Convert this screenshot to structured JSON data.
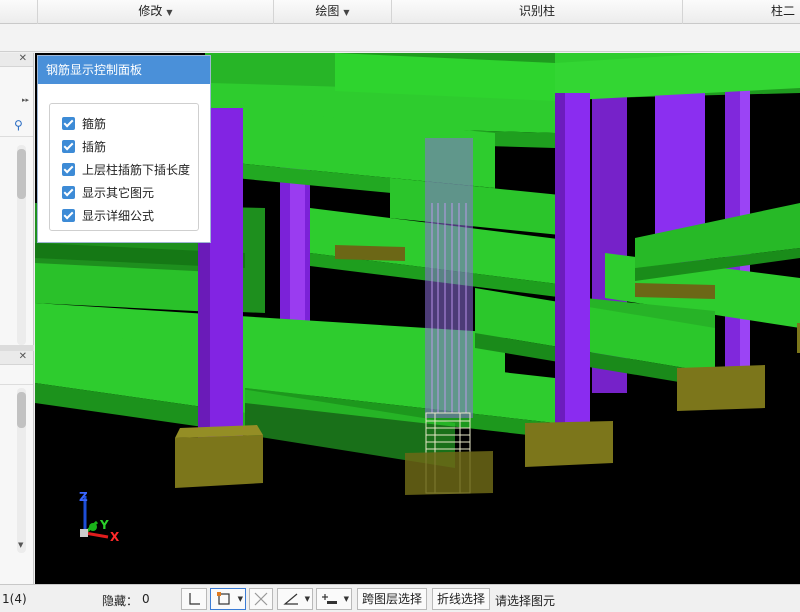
{
  "ribbon": {
    "sections": [
      {
        "label": "修改",
        "has_dropdown": true
      },
      {
        "label": "绘图",
        "has_dropdown": true
      },
      {
        "label": "识别柱",
        "has_dropdown": false
      },
      {
        "label": "柱二次",
        "has_dropdown": false
      }
    ]
  },
  "rebar_panel": {
    "title": "钢筋显示控制面板",
    "options": [
      {
        "label": "箍筋",
        "checked": true
      },
      {
        "label": "插筋",
        "checked": true
      },
      {
        "label": "上层柱插筋下插长度",
        "checked": true
      },
      {
        "label": "显示其它图元",
        "checked": true
      },
      {
        "label": "显示详细公式",
        "checked": true
      }
    ]
  },
  "axes": {
    "z": "Z",
    "y": "Y",
    "x": "X"
  },
  "statusbar": {
    "count": "1(4)",
    "hidden_label": "隐藏：",
    "hidden_value": "0",
    "cross_layer_select": "跨图层选择",
    "polyline_select": "折线选择",
    "prompt": "请选择图元"
  },
  "colors": {
    "beam": "#2ecc2e",
    "column": "#8a2be2",
    "footing": "#807a1e",
    "panel_title": "#4a90d9",
    "viewport_bg": "#000000"
  }
}
